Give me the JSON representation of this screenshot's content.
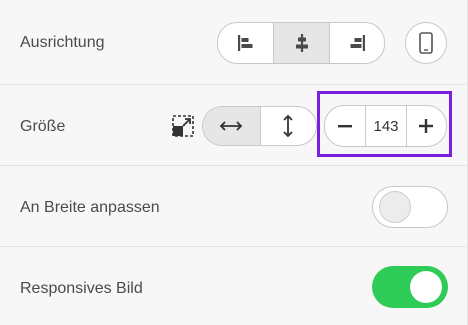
{
  "rows": {
    "alignment": {
      "label": "Ausrichtung",
      "options": [
        "align-left",
        "align-center",
        "align-right"
      ],
      "selected": "align-center"
    },
    "size": {
      "label": "Größe",
      "direction_options": [
        "horizontal",
        "vertical"
      ],
      "selected_direction": "horizontal",
      "value": "143"
    },
    "fit_width": {
      "label": "An Breite anpassen",
      "enabled": false
    },
    "responsive": {
      "label": "Responsives Bild",
      "enabled": true
    }
  },
  "colors": {
    "highlight_frame": "#7a1ee0",
    "toggle_on": "#2ecc57",
    "active_segment": "#e6e6e6"
  },
  "icons": [
    "align-left-icon",
    "align-center-icon",
    "align-right-icon",
    "mobile-device-icon",
    "fit-size-icon",
    "arrows-horizontal-icon",
    "arrows-vertical-icon",
    "minus-icon",
    "plus-icon"
  ]
}
